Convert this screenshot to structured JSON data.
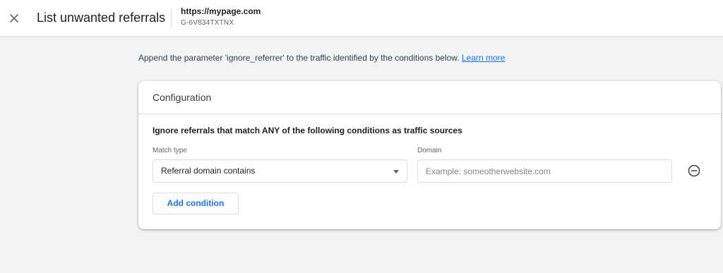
{
  "header": {
    "title": "List unwanted referrals",
    "property_name": "https://mypage.com",
    "property_id": "G-6V834TXTNX"
  },
  "intro": {
    "text": "Append the parameter 'ignore_referrer' to the traffic identified by the conditions below.",
    "link_label": "Learn more"
  },
  "configuration": {
    "title": "Configuration",
    "rule_text": "Ignore referrals that match ANY of the following conditions as traffic sources",
    "match_type_label": "Match type",
    "match_type_value": "Referral domain contains",
    "domain_label": "Domain",
    "domain_value": "",
    "domain_placeholder": "Example: someotherwebsite.com",
    "add_condition_label": "Add condition"
  },
  "icons": {
    "close": "close-icon",
    "remove": "remove-circle-icon",
    "dropdown": "dropdown-caret-icon"
  },
  "colors": {
    "accent": "#1a73e8",
    "background": "#f1f3f4",
    "border": "#dadce0"
  }
}
